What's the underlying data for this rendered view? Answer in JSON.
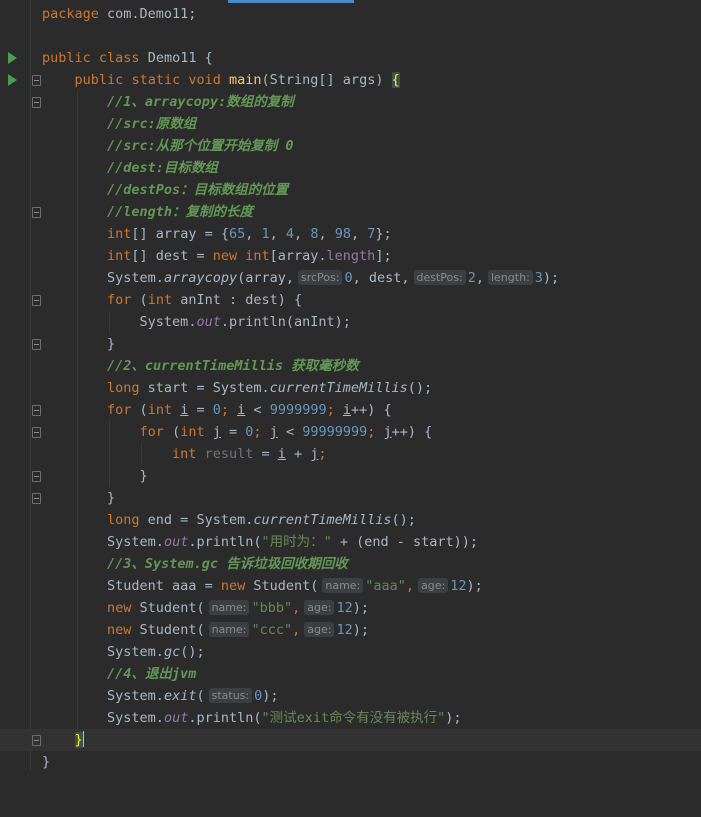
{
  "editor": {
    "lines": [
      {
        "text": "package com.Demo11;"
      },
      {
        "text": ""
      },
      {
        "text": "public class Demo11 {"
      },
      {
        "text": "    public static void main(String[] args) {"
      },
      {
        "text": "        //1、arraycopy:数组的复制"
      },
      {
        "text": "        //src:原数组"
      },
      {
        "text": "        //src:从那个位置开始复制 0"
      },
      {
        "text": "        //dest:目标数组"
      },
      {
        "text": "        //destPos：目标数组的位置"
      },
      {
        "text": "        //length：复制的长度"
      },
      {
        "text": "        int[] array = {65, 1, 4, 8, 98, 7};"
      },
      {
        "text": "        int[] dest = new int[array.length];"
      },
      {
        "text": "        System.arraycopy(array,  srcPos: 0, dest,  destPos: 2,  length: 3);"
      },
      {
        "text": "        for (int anInt : dest) {"
      },
      {
        "text": "            System.out.println(anInt);"
      },
      {
        "text": "        }"
      },
      {
        "text": "        //2、currentTimeMillis 获取毫秒数"
      },
      {
        "text": "        long start = System.currentTimeMillis();"
      },
      {
        "text": "        for (int i = 0; i < 9999999; i++) {"
      },
      {
        "text": "            for (int j = 0; j < 99999999; j++) {"
      },
      {
        "text": "                int result = i + j;"
      },
      {
        "text": "            }"
      },
      {
        "text": "        }"
      },
      {
        "text": "        long end = System.currentTimeMillis();"
      },
      {
        "text": "        System.out.println(\"用时为：\" + (end - start));"
      },
      {
        "text": "        //3、System.gc 告诉垃圾回收期回收"
      },
      {
        "text": "        Student aaa = new Student( name: \"aaa\",  age: 12);"
      },
      {
        "text": "        new Student( name: \"bbb\",  age: 12);"
      },
      {
        "text": "        new Student( name: \"ccc\",  age: 12);"
      },
      {
        "text": "        System.gc();"
      },
      {
        "text": "        //4、退出jvm"
      },
      {
        "text": "        System.exit( status: 0);"
      },
      {
        "text": "        System.out.println(\"测试exit命令有没有被执行\");"
      },
      {
        "text": "    }"
      },
      {
        "text": "}"
      }
    ],
    "tokens": {
      "l0": [
        "package",
        " com.Demo11;"
      ],
      "l2": [
        "public",
        " ",
        "class",
        " Demo11 {"
      ],
      "l3": [
        "public",
        " ",
        "static",
        " ",
        "void",
        " ",
        "main",
        "(String[] args) ",
        "{"
      ],
      "l4": "//1、arraycopy:数组的复制",
      "l5": "//src:原数组",
      "l6": "//src:从那个位置开始复制 0",
      "l7": "//dest:目标数组",
      "l8": "//destPos：目标数组的位置",
      "l9": "//length：复制的长度",
      "l10": [
        "int",
        "[] array = {",
        "65",
        ", ",
        "1",
        ", ",
        "4",
        ", ",
        "8",
        ", ",
        "98",
        ", ",
        "7",
        "};"
      ],
      "l11": [
        "int",
        "[] dest = ",
        "new",
        " ",
        "int",
        "[array.",
        "length",
        "];"
      ],
      "l12": [
        "System.",
        "arraycopy",
        "(array,",
        "srcPos:",
        "0",
        ", dest,",
        "destPos:",
        "2",
        ",",
        "length:",
        "3",
        ");"
      ],
      "l13": [
        "for",
        " (",
        "int",
        " anInt : dest) {"
      ],
      "l14": [
        "System.",
        "out",
        ".println(anInt);"
      ],
      "l15": "}",
      "l16": "//2、currentTimeMillis 获取毫秒数",
      "l17": [
        "long",
        " start = System.",
        "currentTimeMillis",
        "();"
      ],
      "l18": [
        "for",
        " (",
        "int",
        " ",
        "i",
        " = ",
        "0",
        "; ",
        "i",
        " < ",
        "9999999",
        "; ",
        "i",
        "++) {"
      ],
      "l19": [
        "for",
        " (",
        "int",
        " ",
        "j",
        " = ",
        "0",
        "; ",
        "j",
        " < ",
        "99999999",
        "; ",
        "j",
        "++) {"
      ],
      "l20": [
        "int",
        " ",
        "result",
        " = ",
        "i",
        " + ",
        "j",
        ";"
      ],
      "l21": "}",
      "l22": "}",
      "l23": [
        "long",
        " end = System.",
        "currentTimeMillis",
        "();"
      ],
      "l24": [
        "System.",
        "out",
        ".println(",
        "\"用时为：\"",
        " + (end - start));"
      ],
      "l25": "//3、System.gc 告诉垃圾回收期回收",
      "l26": [
        "Student aaa = ",
        "new",
        " Student(",
        "name:",
        "\"aaa\"",
        ",",
        "age:",
        "12",
        ");"
      ],
      "l27": [
        "new",
        " Student(",
        "name:",
        "\"bbb\"",
        ",",
        "age:",
        "12",
        ");"
      ],
      "l28": [
        "new",
        " Student(",
        "name:",
        "\"ccc\"",
        ",",
        "age:",
        "12",
        ");"
      ],
      "l29": [
        "System.",
        "gc",
        "();"
      ],
      "l30": "//4、退出jvm",
      "l31": [
        "System.",
        "exit",
        "(",
        "status:",
        "0",
        ");"
      ],
      "l32": [
        "System.",
        "out",
        ".println(",
        "\"测试exit命令有没有被执行\"",
        ");"
      ],
      "l33": "}",
      "l34": "}"
    }
  },
  "colors": {
    "background": "#2b2b2b",
    "keyword": "#cc7832",
    "method": "#ffc66d",
    "number": "#6897bb",
    "string": "#6a8759",
    "comment": "#629755",
    "field": "#9876aa",
    "run_icon": "#499c54"
  },
  "gutter": {
    "run_icons": [
      "run-class-icon",
      "run-main-icon"
    ]
  }
}
